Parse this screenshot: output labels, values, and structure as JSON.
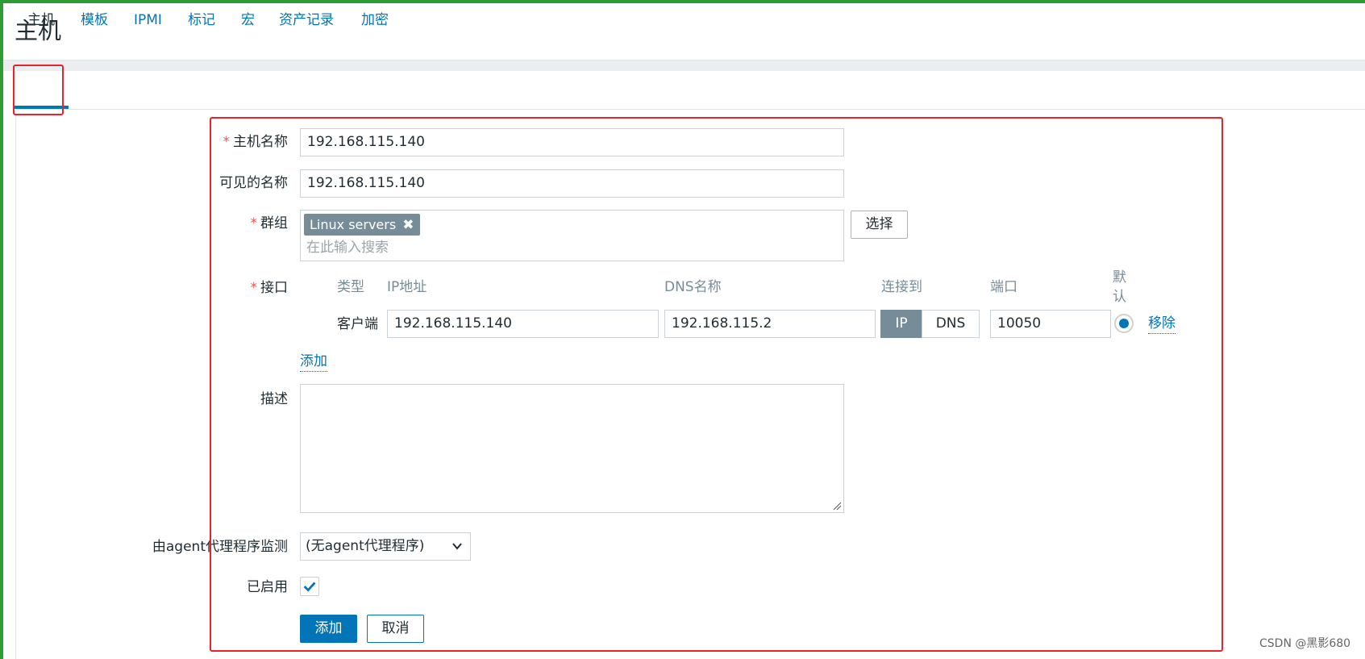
{
  "page": {
    "title": "主机"
  },
  "tabs": [
    {
      "label": "主机"
    },
    {
      "label": "模板"
    },
    {
      "label": "IPMI"
    },
    {
      "label": "标记"
    },
    {
      "label": "宏"
    },
    {
      "label": "资产记录"
    },
    {
      "label": "加密"
    }
  ],
  "form": {
    "host_name": {
      "label": "主机名称",
      "value": "192.168.115.140"
    },
    "visible_name": {
      "label": "可见的名称",
      "value": "192.168.115.140"
    },
    "groups": {
      "label": "群组",
      "chip": "Linux servers",
      "placeholder": "在此输入搜索",
      "select_label": "选择"
    },
    "interfaces": {
      "label": "接口",
      "headers": {
        "type": "类型",
        "ip": "IP地址",
        "dns": "DNS名称",
        "connect": "连接到",
        "port": "端口",
        "default": "默认"
      },
      "row": {
        "type": "客户端",
        "ip": "192.168.115.140",
        "dns": "192.168.115.2",
        "connect_ip": "IP",
        "connect_dns": "DNS",
        "port": "10050",
        "remove": "移除"
      },
      "add_link": "添加"
    },
    "description": {
      "label": "描述",
      "value": ""
    },
    "proxy": {
      "label": "由agent代理程序监测",
      "value": "(无agent代理程序)"
    },
    "enabled": {
      "label": "已启用",
      "checked": true
    },
    "buttons": {
      "add": "添加",
      "cancel": "取消"
    }
  },
  "watermark": "CSDN @黑影680",
  "colors": {
    "accent": "#0275b8",
    "annotation_red": "#e8242a",
    "chip_grey": "#768d99",
    "frame_green": "#2e9b35"
  }
}
